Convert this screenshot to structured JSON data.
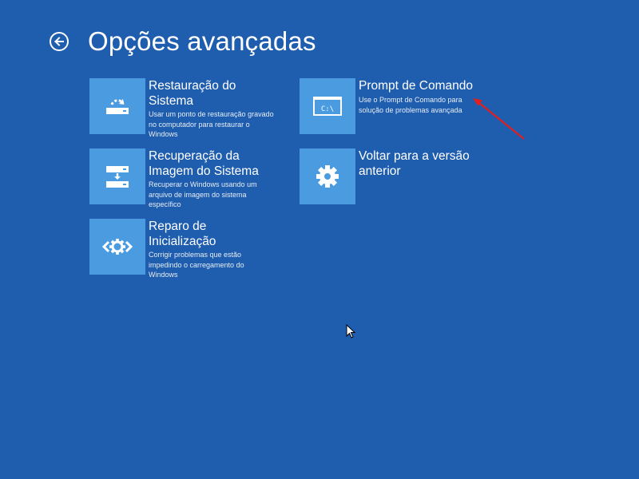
{
  "header": {
    "back_icon": "back-arrow-circle-icon",
    "title": "Opções avançadas"
  },
  "options": [
    {
      "id": "system-restore",
      "icon": "system-restore-icon",
      "title_line1": "Restauração do",
      "title_line2": "Sistema",
      "desc_line1": "Usar um ponto de restauração gravado",
      "desc_line2": "no computador para restaurar o",
      "desc_line3": "Windows"
    },
    {
      "id": "system-image-recovery",
      "icon": "system-image-recovery-icon",
      "title_line1": "Recuperação da",
      "title_line2": "Imagem do Sistema",
      "desc_line1": "Recuperar o Windows usando um",
      "desc_line2": "arquivo de imagem do sistema",
      "desc_line3": "específico"
    },
    {
      "id": "startup-repair",
      "icon": "startup-repair-icon",
      "title_line1": "Reparo de",
      "title_line2": "Inicialização",
      "desc_line1": "Corrigir problemas que estão",
      "desc_line2": "impedindo o carregamento do",
      "desc_line3": "Windows"
    },
    {
      "id": "command-prompt",
      "icon": "command-prompt-icon",
      "icon_text": "C:\\",
      "title_line1": "Prompt de Comando",
      "desc_line1": "Use o Prompt de Comando para",
      "desc_line2": "solução de problemas avançada"
    },
    {
      "id": "go-back",
      "icon": "gear-icon",
      "title_line1": "Voltar para a versão",
      "title_line2": "anterior"
    }
  ],
  "colors": {
    "background": "#1F5DAE",
    "tile": "#4B9BE0",
    "annotation_arrow": "#E02020"
  }
}
